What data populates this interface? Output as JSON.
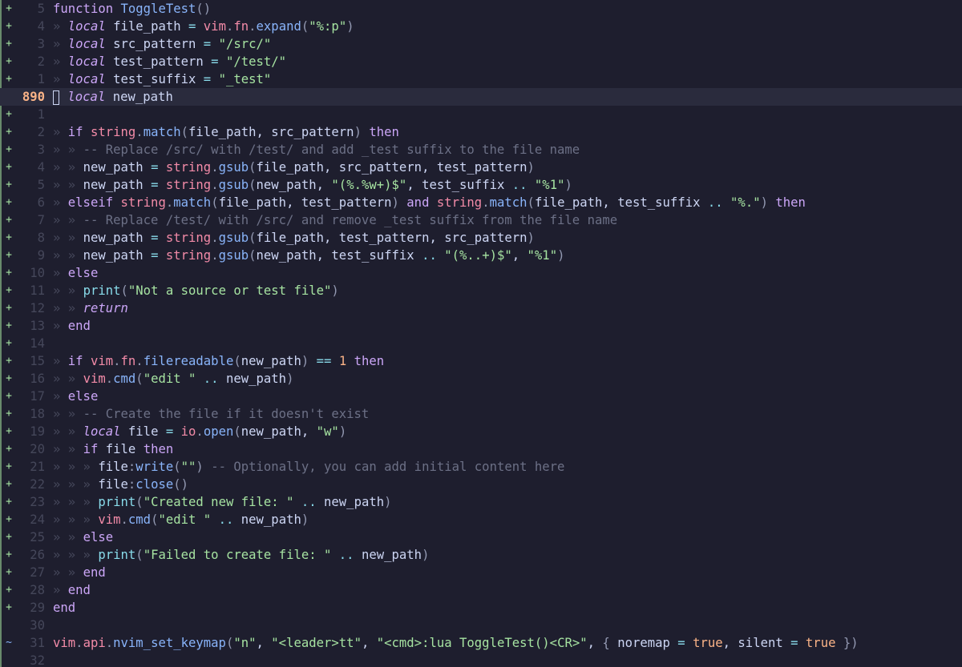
{
  "editor": {
    "colors": {
      "background": "#1e1e2e",
      "current_line": "#2a2b3d",
      "added_sign": "#a6e3a1"
    },
    "lines": [
      {
        "sign": "+",
        "num": "5",
        "tokens": [
          [
            "kw",
            "function "
          ],
          [
            "fn",
            "ToggleTest"
          ],
          [
            "pun",
            "()"
          ]
        ]
      },
      {
        "sign": "+",
        "num": "4",
        "tokens": [
          [
            "ind",
            "» "
          ],
          [
            "kwi",
            "local"
          ],
          [
            "var",
            " file_path "
          ],
          [
            "op",
            "="
          ],
          [
            "var",
            " "
          ],
          [
            "lib",
            "vim"
          ],
          [
            "pun",
            "."
          ],
          [
            "lib",
            "fn"
          ],
          [
            "pun",
            "."
          ],
          [
            "fn",
            "expand"
          ],
          [
            "pun",
            "("
          ],
          [
            "str",
            "\"%:p\""
          ],
          [
            "pun",
            ")"
          ]
        ]
      },
      {
        "sign": "+",
        "num": "3",
        "tokens": [
          [
            "ind",
            "» "
          ],
          [
            "kwi",
            "local"
          ],
          [
            "var",
            " src_pattern "
          ],
          [
            "op",
            "="
          ],
          [
            "var",
            " "
          ],
          [
            "str",
            "\"/src/\""
          ]
        ]
      },
      {
        "sign": "+",
        "num": "2",
        "tokens": [
          [
            "ind",
            "» "
          ],
          [
            "kwi",
            "local"
          ],
          [
            "var",
            " test_pattern "
          ],
          [
            "op",
            "="
          ],
          [
            "var",
            " "
          ],
          [
            "str",
            "\"/test/\""
          ]
        ]
      },
      {
        "sign": "+",
        "num": "1",
        "tokens": [
          [
            "ind",
            "» "
          ],
          [
            "kwi",
            "local"
          ],
          [
            "var",
            " test_suffix "
          ],
          [
            "op",
            "="
          ],
          [
            "var",
            " "
          ],
          [
            "str",
            "\"_test\""
          ]
        ]
      },
      {
        "sign": "",
        "num": "890",
        "current": true,
        "cursor": true,
        "tokens": [
          [
            "ind",
            " "
          ],
          [
            "kwi",
            "local"
          ],
          [
            "var",
            " new_path"
          ]
        ]
      },
      {
        "sign": "+",
        "num": "1",
        "tokens": []
      },
      {
        "sign": "+",
        "num": "2",
        "tokens": [
          [
            "ind",
            "» "
          ],
          [
            "kw",
            "if "
          ],
          [
            "lib",
            "string"
          ],
          [
            "pun",
            "."
          ],
          [
            "fn",
            "match"
          ],
          [
            "pun",
            "("
          ],
          [
            "var",
            "file_path, src_pattern"
          ],
          [
            "pun",
            ")"
          ],
          [
            "kw",
            " then"
          ]
        ]
      },
      {
        "sign": "+",
        "num": "3",
        "tokens": [
          [
            "ind",
            "» » "
          ],
          [
            "cm",
            "-- Replace /src/ with /test/ and add _test suffix to the file name"
          ]
        ]
      },
      {
        "sign": "+",
        "num": "4",
        "tokens": [
          [
            "ind",
            "» » "
          ],
          [
            "var",
            "new_path "
          ],
          [
            "op",
            "="
          ],
          [
            "var",
            " "
          ],
          [
            "lib",
            "string"
          ],
          [
            "pun",
            "."
          ],
          [
            "fn",
            "gsub"
          ],
          [
            "pun",
            "("
          ],
          [
            "var",
            "file_path, src_pattern, test_pattern"
          ],
          [
            "pun",
            ")"
          ]
        ]
      },
      {
        "sign": "+",
        "num": "5",
        "tokens": [
          [
            "ind",
            "» » "
          ],
          [
            "var",
            "new_path "
          ],
          [
            "op",
            "="
          ],
          [
            "var",
            " "
          ],
          [
            "lib",
            "string"
          ],
          [
            "pun",
            "."
          ],
          [
            "fn",
            "gsub"
          ],
          [
            "pun",
            "("
          ],
          [
            "var",
            "new_path, "
          ],
          [
            "str",
            "\"(%.%w+)$\""
          ],
          [
            "var",
            ", test_suffix "
          ],
          [
            "op",
            ".."
          ],
          [
            "var",
            " "
          ],
          [
            "str",
            "\"%1\""
          ],
          [
            "pun",
            ")"
          ]
        ]
      },
      {
        "sign": "+",
        "num": "6",
        "tokens": [
          [
            "ind",
            "» "
          ],
          [
            "kw",
            "elseif "
          ],
          [
            "lib",
            "string"
          ],
          [
            "pun",
            "."
          ],
          [
            "fn",
            "match"
          ],
          [
            "pun",
            "("
          ],
          [
            "var",
            "file_path, test_pattern"
          ],
          [
            "pun",
            ")"
          ],
          [
            "kw",
            " and "
          ],
          [
            "lib",
            "string"
          ],
          [
            "pun",
            "."
          ],
          [
            "fn",
            "match"
          ],
          [
            "pun",
            "("
          ],
          [
            "var",
            "file_path, test_suffix "
          ],
          [
            "op",
            ".."
          ],
          [
            "var",
            " "
          ],
          [
            "str",
            "\"%.\""
          ],
          [
            "pun",
            ")"
          ],
          [
            "kw",
            " then"
          ]
        ]
      },
      {
        "sign": "+",
        "num": "7",
        "tokens": [
          [
            "ind",
            "» » "
          ],
          [
            "cm",
            "-- Replace /test/ with /src/ and remove _test suffix from the file name"
          ]
        ]
      },
      {
        "sign": "+",
        "num": "8",
        "tokens": [
          [
            "ind",
            "» » "
          ],
          [
            "var",
            "new_path "
          ],
          [
            "op",
            "="
          ],
          [
            "var",
            " "
          ],
          [
            "lib",
            "string"
          ],
          [
            "pun",
            "."
          ],
          [
            "fn",
            "gsub"
          ],
          [
            "pun",
            "("
          ],
          [
            "var",
            "file_path, test_pattern, src_pattern"
          ],
          [
            "pun",
            ")"
          ]
        ]
      },
      {
        "sign": "+",
        "num": "9",
        "tokens": [
          [
            "ind",
            "» » "
          ],
          [
            "var",
            "new_path "
          ],
          [
            "op",
            "="
          ],
          [
            "var",
            " "
          ],
          [
            "lib",
            "string"
          ],
          [
            "pun",
            "."
          ],
          [
            "fn",
            "gsub"
          ],
          [
            "pun",
            "("
          ],
          [
            "var",
            "new_path, test_suffix "
          ],
          [
            "op",
            ".."
          ],
          [
            "var",
            " "
          ],
          [
            "str",
            "\"(%..+)$\""
          ],
          [
            "var",
            ", "
          ],
          [
            "str",
            "\"%1\""
          ],
          [
            "pun",
            ")"
          ]
        ]
      },
      {
        "sign": "+",
        "num": "10",
        "tokens": [
          [
            "ind",
            "» "
          ],
          [
            "kw",
            "else"
          ]
        ]
      },
      {
        "sign": "+",
        "num": "11",
        "tokens": [
          [
            "ind",
            "» » "
          ],
          [
            "pfn",
            "print"
          ],
          [
            "pun",
            "("
          ],
          [
            "str",
            "\"Not a source or test file\""
          ],
          [
            "pun",
            ")"
          ]
        ]
      },
      {
        "sign": "+",
        "num": "12",
        "tokens": [
          [
            "ind",
            "» » "
          ],
          [
            "kwi",
            "return"
          ]
        ]
      },
      {
        "sign": "+",
        "num": "13",
        "tokens": [
          [
            "ind",
            "» "
          ],
          [
            "kw",
            "end"
          ]
        ]
      },
      {
        "sign": "+",
        "num": "14",
        "tokens": []
      },
      {
        "sign": "+",
        "num": "15",
        "tokens": [
          [
            "ind",
            "» "
          ],
          [
            "kw",
            "if "
          ],
          [
            "lib",
            "vim"
          ],
          [
            "pun",
            "."
          ],
          [
            "lib",
            "fn"
          ],
          [
            "pun",
            "."
          ],
          [
            "fn",
            "filereadable"
          ],
          [
            "pun",
            "("
          ],
          [
            "var",
            "new_path"
          ],
          [
            "pun",
            ")"
          ],
          [
            "var",
            " "
          ],
          [
            "op",
            "=="
          ],
          [
            "var",
            " "
          ],
          [
            "num",
            "1"
          ],
          [
            "kw",
            " then"
          ]
        ]
      },
      {
        "sign": "+",
        "num": "16",
        "tokens": [
          [
            "ind",
            "» » "
          ],
          [
            "lib",
            "vim"
          ],
          [
            "pun",
            "."
          ],
          [
            "fn",
            "cmd"
          ],
          [
            "pun",
            "("
          ],
          [
            "str",
            "\"edit \""
          ],
          [
            "var",
            " "
          ],
          [
            "op",
            ".."
          ],
          [
            "var",
            " new_path"
          ],
          [
            "pun",
            ")"
          ]
        ]
      },
      {
        "sign": "+",
        "num": "17",
        "tokens": [
          [
            "ind",
            "» "
          ],
          [
            "kw",
            "else"
          ]
        ]
      },
      {
        "sign": "+",
        "num": "18",
        "tokens": [
          [
            "ind",
            "» » "
          ],
          [
            "cm",
            "-- Create the file if it doesn't exist"
          ]
        ]
      },
      {
        "sign": "+",
        "num": "19",
        "tokens": [
          [
            "ind",
            "» » "
          ],
          [
            "kwi",
            "local"
          ],
          [
            "var",
            " file "
          ],
          [
            "op",
            "="
          ],
          [
            "var",
            " "
          ],
          [
            "lib",
            "io"
          ],
          [
            "pun",
            "."
          ],
          [
            "fn",
            "open"
          ],
          [
            "pun",
            "("
          ],
          [
            "var",
            "new_path, "
          ],
          [
            "str",
            "\"w\""
          ],
          [
            "pun",
            ")"
          ]
        ]
      },
      {
        "sign": "+",
        "num": "20",
        "tokens": [
          [
            "ind",
            "» » "
          ],
          [
            "kw",
            "if "
          ],
          [
            "var",
            "file "
          ],
          [
            "kw",
            "then"
          ]
        ]
      },
      {
        "sign": "+",
        "num": "21",
        "tokens": [
          [
            "ind",
            "» » » "
          ],
          [
            "var",
            "file"
          ],
          [
            "pun",
            ":"
          ],
          [
            "fn",
            "write"
          ],
          [
            "pun",
            "("
          ],
          [
            "str",
            "\"\""
          ],
          [
            "pun",
            ")"
          ],
          [
            "var",
            " "
          ],
          [
            "cm",
            "-- Optionally, you can add initial content here"
          ]
        ]
      },
      {
        "sign": "+",
        "num": "22",
        "tokens": [
          [
            "ind",
            "» » » "
          ],
          [
            "var",
            "file"
          ],
          [
            "pun",
            ":"
          ],
          [
            "fn",
            "close"
          ],
          [
            "pun",
            "()"
          ]
        ]
      },
      {
        "sign": "+",
        "num": "23",
        "tokens": [
          [
            "ind",
            "» » » "
          ],
          [
            "pfn",
            "print"
          ],
          [
            "pun",
            "("
          ],
          [
            "str",
            "\"Created new file: \""
          ],
          [
            "var",
            " "
          ],
          [
            "op",
            ".."
          ],
          [
            "var",
            " new_path"
          ],
          [
            "pun",
            ")"
          ]
        ]
      },
      {
        "sign": "+",
        "num": "24",
        "tokens": [
          [
            "ind",
            "» » » "
          ],
          [
            "lib",
            "vim"
          ],
          [
            "pun",
            "."
          ],
          [
            "fn",
            "cmd"
          ],
          [
            "pun",
            "("
          ],
          [
            "str",
            "\"edit \""
          ],
          [
            "var",
            " "
          ],
          [
            "op",
            ".."
          ],
          [
            "var",
            " new_path"
          ],
          [
            "pun",
            ")"
          ]
        ]
      },
      {
        "sign": "+",
        "num": "25",
        "tokens": [
          [
            "ind",
            "» » "
          ],
          [
            "kw",
            "else"
          ]
        ]
      },
      {
        "sign": "+",
        "num": "26",
        "tokens": [
          [
            "ind",
            "» » » "
          ],
          [
            "pfn",
            "print"
          ],
          [
            "pun",
            "("
          ],
          [
            "str",
            "\"Failed to create file: \""
          ],
          [
            "var",
            " "
          ],
          [
            "op",
            ".."
          ],
          [
            "var",
            " new_path"
          ],
          [
            "pun",
            ")"
          ]
        ]
      },
      {
        "sign": "+",
        "num": "27",
        "tokens": [
          [
            "ind",
            "» » "
          ],
          [
            "kw",
            "end"
          ]
        ]
      },
      {
        "sign": "+",
        "num": "28",
        "tokens": [
          [
            "ind",
            "» "
          ],
          [
            "kw",
            "end"
          ]
        ]
      },
      {
        "sign": "+",
        "num": "29",
        "tokens": [
          [
            "kw",
            "end"
          ]
        ]
      },
      {
        "sign": "",
        "num": "30",
        "tokens": []
      },
      {
        "sign": "~",
        "num": "31",
        "tokens": [
          [
            "lib",
            "vim"
          ],
          [
            "pun",
            "."
          ],
          [
            "lib",
            "api"
          ],
          [
            "pun",
            "."
          ],
          [
            "fn",
            "nvim_set_keymap"
          ],
          [
            "pun",
            "("
          ],
          [
            "str",
            "\"n\""
          ],
          [
            "var",
            ", "
          ],
          [
            "str",
            "\"<leader>tt\""
          ],
          [
            "var",
            ", "
          ],
          [
            "str",
            "\"<cmd>:lua ToggleTest()<CR>\""
          ],
          [
            "var",
            ", "
          ],
          [
            "pun",
            "{ "
          ],
          [
            "var",
            "noremap "
          ],
          [
            "op",
            "="
          ],
          [
            "var",
            " "
          ],
          [
            "bool",
            "true"
          ],
          [
            "var",
            ", silent "
          ],
          [
            "op",
            "="
          ],
          [
            "var",
            " "
          ],
          [
            "bool",
            "true"
          ],
          [
            "var",
            " "
          ],
          [
            "pun",
            "})"
          ]
        ]
      },
      {
        "sign": "",
        "num": "32",
        "tokens": []
      }
    ]
  }
}
